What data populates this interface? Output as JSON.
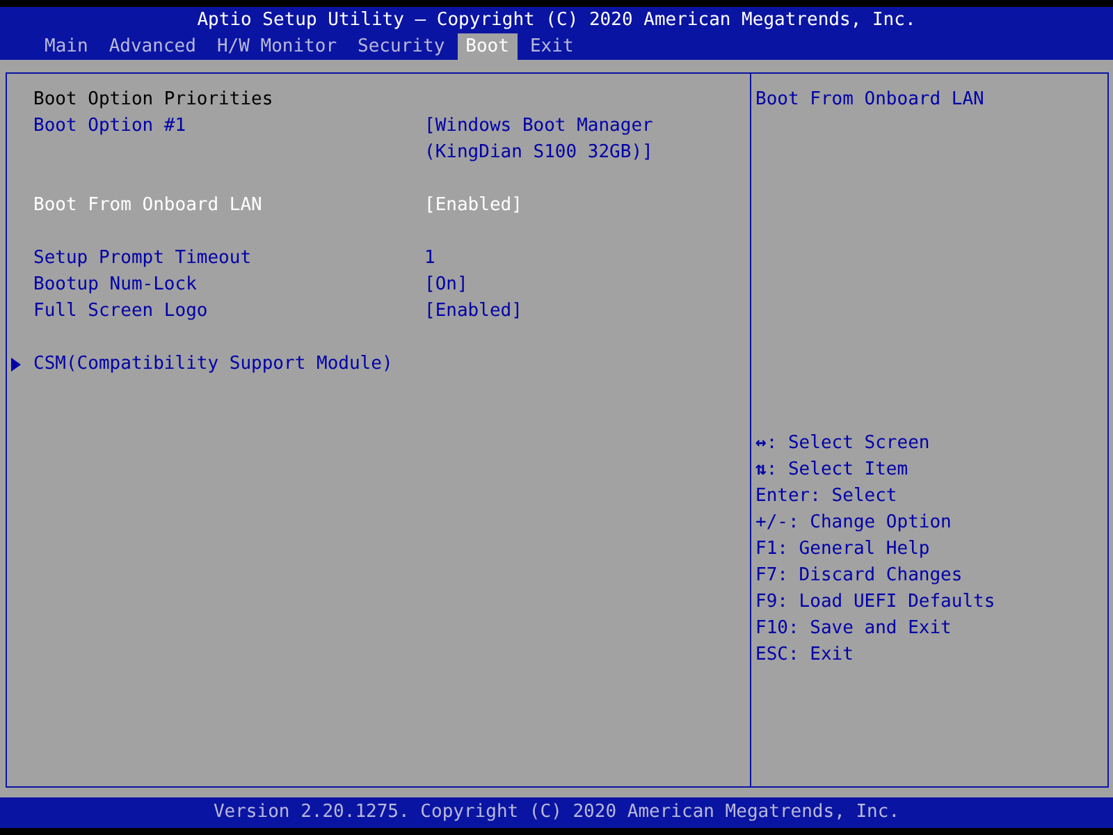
{
  "title": "Aptio Setup Utility – Copyright (C) 2020 American Megatrends, Inc.",
  "tabs": [
    {
      "label": "Main",
      "selected": false
    },
    {
      "label": "Advanced",
      "selected": false
    },
    {
      "label": "H/W Monitor",
      "selected": false
    },
    {
      "label": "Security",
      "selected": false
    },
    {
      "label": "Boot",
      "selected": true
    },
    {
      "label": "Exit",
      "selected": false
    }
  ],
  "settings_groups": [
    [
      {
        "kind": "heading",
        "label": "Boot Option Priorities",
        "selected": false
      },
      {
        "kind": "option",
        "label": "Boot Option #1",
        "value_lines": [
          "[Windows Boot Manager",
          "(KingDian S100 32GB)]"
        ],
        "selected": false
      }
    ],
    [
      {
        "kind": "option",
        "label": "Boot From Onboard LAN",
        "value_lines": [
          "[Enabled]"
        ],
        "selected": true
      }
    ],
    [
      {
        "kind": "option",
        "label": "Setup Prompt Timeout",
        "value_lines": [
          "1"
        ],
        "selected": false
      },
      {
        "kind": "option",
        "label": "Bootup Num-Lock",
        "value_lines": [
          "[On]"
        ],
        "selected": false
      },
      {
        "kind": "option",
        "label": "Full Screen Logo",
        "value_lines": [
          "[Enabled]"
        ],
        "selected": false
      }
    ],
    [
      {
        "kind": "submenu",
        "label": "CSM(Compatibility Support Module)",
        "selected": false
      }
    ]
  ],
  "help_text": "Boot From Onboard LAN",
  "key_help": [
    {
      "key": "↔",
      "action": ": Select Screen"
    },
    {
      "key": "⇅",
      "action": ": Select Item"
    },
    {
      "action": "Enter: Select"
    },
    {
      "action": "+/-: Change Option"
    },
    {
      "action": "F1: General Help"
    },
    {
      "action": "F7: Discard Changes"
    },
    {
      "action": "F9: Load UEFI Defaults"
    },
    {
      "action": "F10: Save and Exit"
    },
    {
      "action": "ESC: Exit"
    }
  ],
  "footer": "Version 2.20.1275. Copyright (C) 2020 American Megatrends, Inc."
}
